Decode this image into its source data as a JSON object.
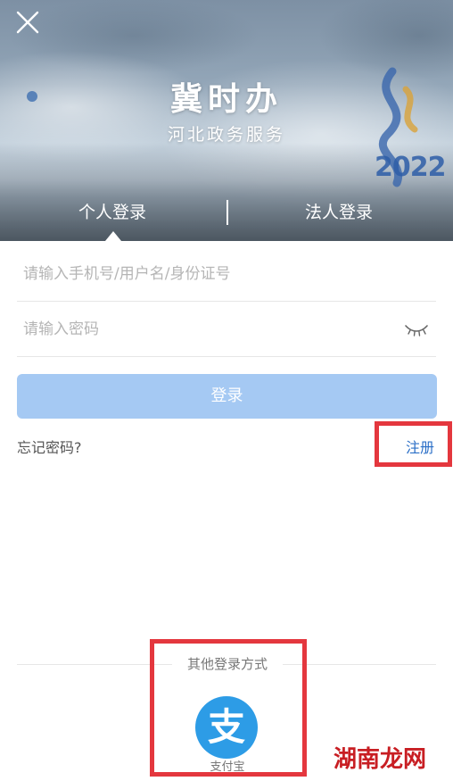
{
  "header": {
    "app_title": "冀时办",
    "app_subtitle": "河北政务服务",
    "hero_logo_year": "2022"
  },
  "tabs": [
    {
      "label": "个人登录",
      "active": true
    },
    {
      "label": "法人登录",
      "active": false
    }
  ],
  "form": {
    "username_placeholder": "请输入手机号/用户名/身份证号",
    "username_value": "",
    "password_placeholder": "请输入密码",
    "password_value": "",
    "login_label": "登录",
    "forgot_label": "忘记密码?",
    "register_label": "注册"
  },
  "other_login": {
    "heading": "其他登录方式",
    "alipay_glyph": "支",
    "alipay_label": "支付宝"
  },
  "watermark": "湖南龙网",
  "colors": {
    "accent": "#2b6fc7",
    "login_button": "#a5c9f3",
    "alipay": "#2d9ce6",
    "highlight": "#e4373e"
  },
  "icons": [
    "close-icon",
    "eye-closed-icon",
    "alipay-icon"
  ]
}
